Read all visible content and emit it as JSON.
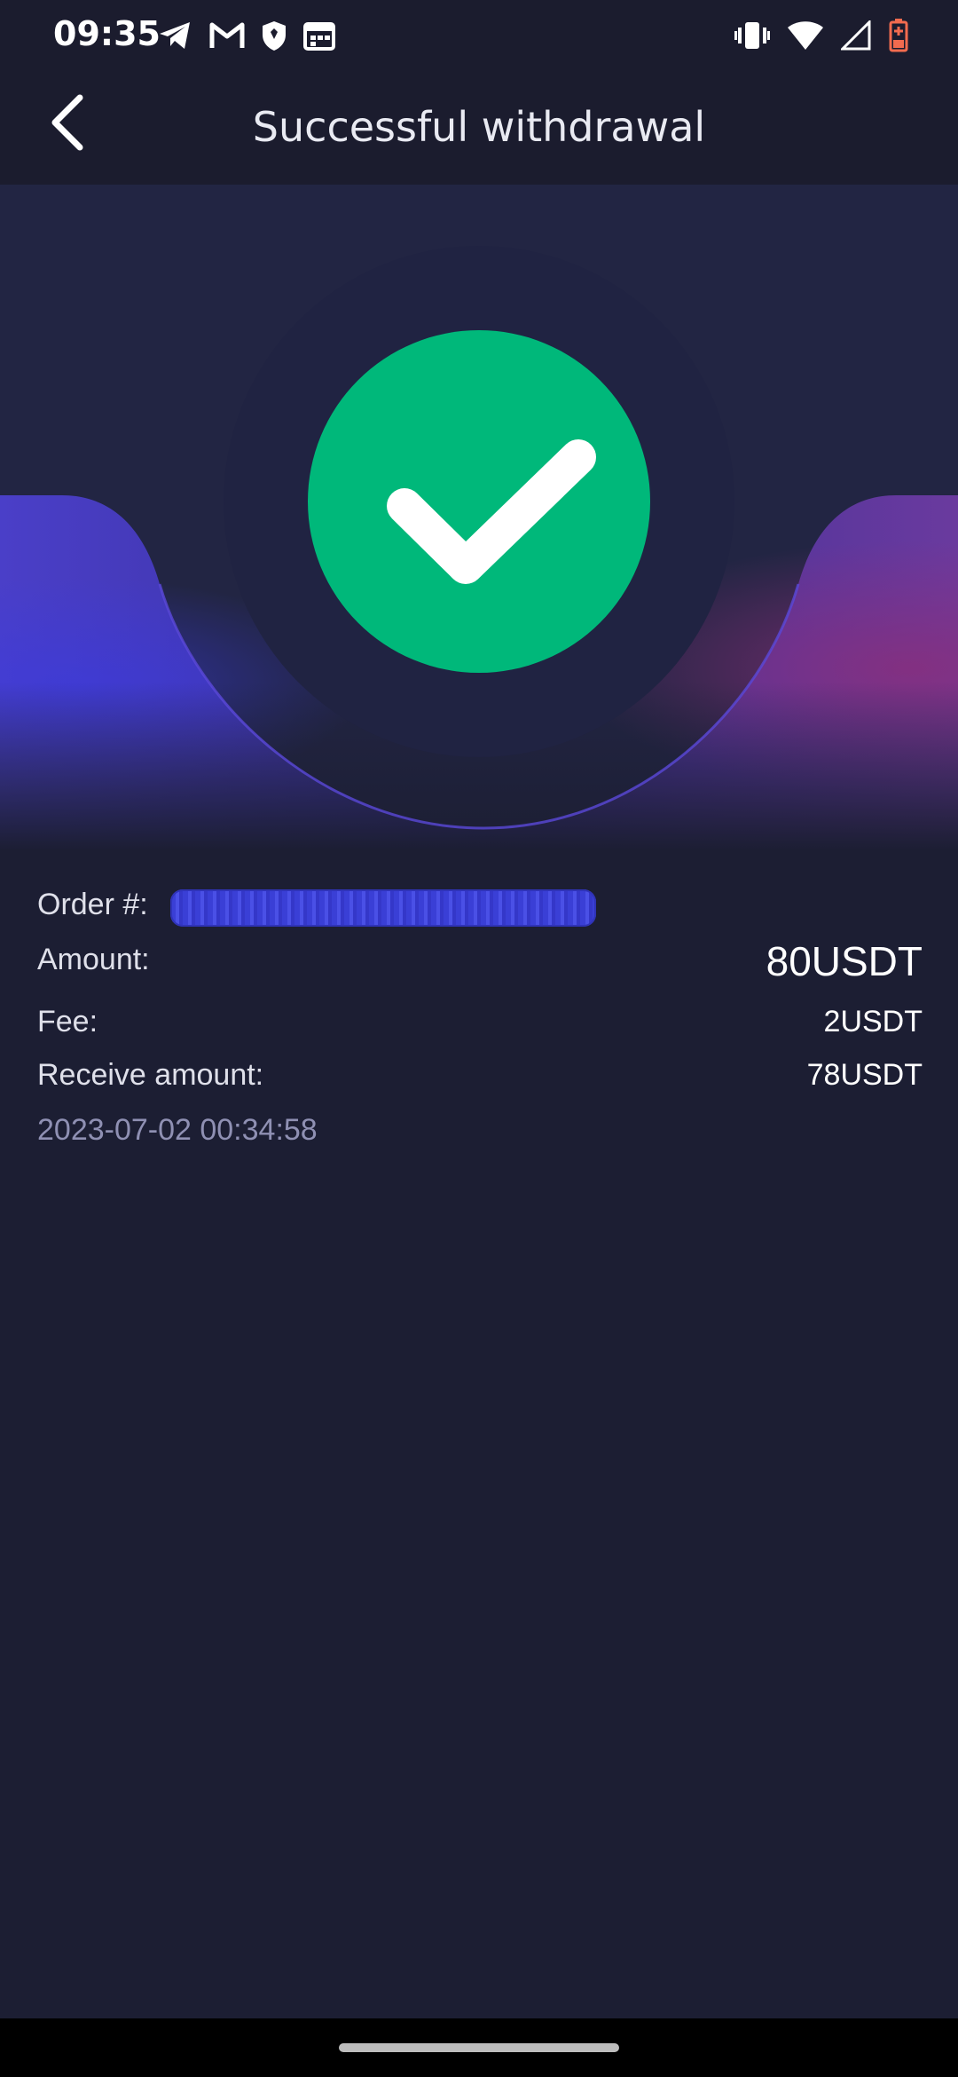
{
  "status_bar": {
    "time": "09:35",
    "left_icons": [
      "telegram-icon",
      "gmail-icon",
      "shield-icon",
      "calendar-icon"
    ],
    "right_icons": [
      "vibrate-icon",
      "wifi-icon",
      "signal-icon",
      "battery-icon"
    ]
  },
  "header": {
    "title": "Successful withdrawal",
    "back_icon": "chevron-left-icon"
  },
  "hero": {
    "status_icon": "check-circle-icon",
    "success_color": "#00b87a",
    "accent_color": "#5a3fc0"
  },
  "details": {
    "order_label": "Order #:",
    "amount_label": "Amount:",
    "amount_value": "80USDT",
    "fee_label": "Fee:",
    "fee_value": "2USDT",
    "receive_label": "Receive amount:",
    "receive_value": "78USDT",
    "timestamp": "2023-07-02 00:34:58"
  }
}
